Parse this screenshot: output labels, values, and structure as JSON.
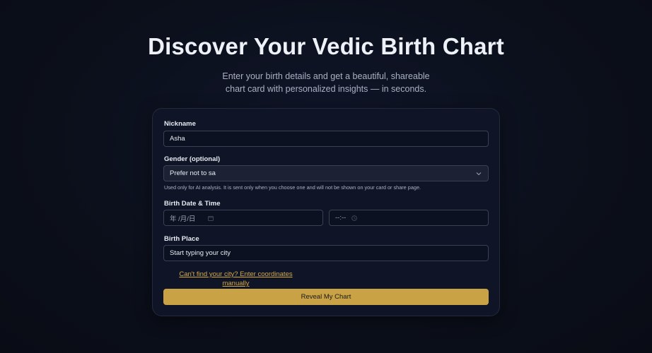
{
  "hero": {
    "title": "Discover Your Vedic Birth Chart",
    "subtitle": "Enter your birth details and get a beautiful, shareable chart card with personalized insights — in seconds."
  },
  "form": {
    "nickname": {
      "label": "Nickname",
      "value": "Asha"
    },
    "gender": {
      "label": "Gender (optional)",
      "value": "Prefer not to sa",
      "hint": "Used only for AI analysis. It is sent only when you choose one and will not be shown on your card or share page."
    },
    "birth_datetime": {
      "label": "Birth Date & Time",
      "date_placeholder": "年 /月/日",
      "time_placeholder": "--:--"
    },
    "birth_place": {
      "label": "Birth Place",
      "value": "Start typing your city"
    },
    "manual_link": "Can't find your city? Enter coordinates manually",
    "submit_label": "Reveal My Chart"
  },
  "icons": [
    "chevron-down-icon",
    "calendar-icon",
    "clock-icon"
  ],
  "colors": {
    "background": "#0b0f1a",
    "card": "#0f1526",
    "accent": "#c9a246",
    "link": "#d4a94a"
  }
}
